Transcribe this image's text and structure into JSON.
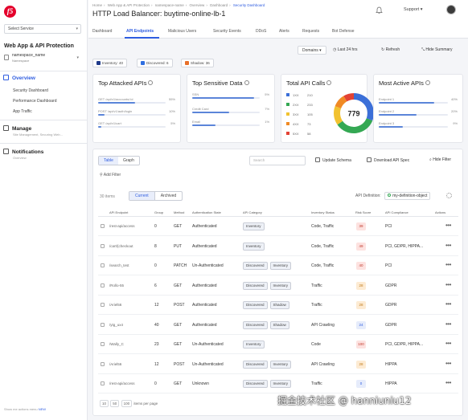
{
  "sidebar": {
    "logo": "f5",
    "select_service": "Select Service",
    "app_title": "Web App & API Protection",
    "namespace_name": "namespace_name",
    "namespace_sub": "Namespace",
    "overview": "Overview",
    "overview_items": [
      "Security Dashboard",
      "Performance Dashboard",
      "App Traffic"
    ],
    "manage": "Manage",
    "manage_sub": "Site Management, Securing Web...",
    "notifications": "Notifications",
    "notifications_sub": "Overview",
    "footer": "Show me actions menu",
    "footer_toggle": "NEW"
  },
  "header": {
    "breadcrumb": [
      "Home",
      "Web App & API Protection",
      "namespace-name",
      "Overview",
      "Dashboard",
      "Security Dashboard"
    ],
    "title": "HTTP Load Balancer: buytime-online-lb-1",
    "support": "Support"
  },
  "tabs": [
    "Dashboard",
    "API Endpoints",
    "Malicious Users",
    "Security Events",
    "DDoS",
    "Alerts",
    "Requests",
    "Bot Defense"
  ],
  "active_tab": "API Endpoints",
  "controls": {
    "dropdown": "Domains",
    "time": "Last 24 hrs",
    "refresh": "Refresh",
    "hide_summary": "Hide Summary"
  },
  "chips": [
    {
      "label": "Inventory: 40",
      "color": "#1f3a8a"
    },
    {
      "label": "Discovered: 6",
      "color": "#2f6fe0"
    },
    {
      "label": "Shadow: 36",
      "color": "#e8702a"
    }
  ],
  "cards": {
    "top_attacked": {
      "title": "Top Attacked APIs",
      "rows": [
        {
          "label": "GET /api/v1/accounts/:id",
          "pct": "55%",
          "fill": 0.55
        },
        {
          "label": "POST /api/v1/auth/login",
          "pct": "10%",
          "fill": 0.1
        },
        {
          "label": "GET /api/v1/cart",
          "pct": "5%",
          "fill": 0.05
        }
      ]
    },
    "top_sensitive": {
      "title": "Top Sensitive Data",
      "rows": [
        {
          "label": "SSN",
          "pct": "5%",
          "fill": 0.92
        },
        {
          "label": "Credit Card",
          "pct": "7%",
          "fill": 0.55
        },
        {
          "label": "Email",
          "pct": "1%",
          "fill": 0.35
        }
      ]
    },
    "total_calls": {
      "title": "Total API Calls",
      "total": "779",
      "rows": [
        {
          "code": "1XX",
          "value": "210",
          "color": "#3b6fd8"
        },
        {
          "code": "2XX",
          "value": "233",
          "color": "#34a853"
        },
        {
          "code": "3XX",
          "value": "105",
          "color": "#f2c230"
        },
        {
          "code": "4XX",
          "value": "73",
          "color": "#f08a24"
        },
        {
          "code": "5XX",
          "value": "58",
          "color": "#e34234"
        }
      ]
    },
    "most_active": {
      "title": "Most Active APIs",
      "rows": [
        {
          "label": "Endpoint 1",
          "pct": "40%",
          "fill": 0.8
        },
        {
          "label": "Endpoint 2",
          "pct": "20%",
          "fill": 0.55
        },
        {
          "label": "Endpoint 3",
          "pct": "9%",
          "fill": 0.35
        }
      ]
    }
  },
  "toolbar": {
    "views": [
      "Table",
      "Graph"
    ],
    "search_placeholder": "Search",
    "update_schema": "Update Schema",
    "download_spec": "Download API Spec",
    "hide_filter": "Hide Filter",
    "add_filter": "Add Filter"
  },
  "table_head": {
    "count": "30 items",
    "segments": [
      "Current",
      "Archived"
    ],
    "api_definition_label": "API Definition:",
    "api_definition_value": "my-definition-object"
  },
  "columns": [
    "API Endpoint",
    "Group",
    "Method",
    "Authentication State",
    "API Category",
    "Inventory Status",
    "Risk Score",
    "API Compliance",
    "Actions"
  ],
  "rows": [
    {
      "endpoint": "/rest-api/access",
      "group": "0",
      "method": "GET",
      "auth": "Authenticated",
      "cats": [
        "Inventory"
      ],
      "status": "Code, Traffic",
      "risk": "39",
      "compliance": "PCI"
    },
    {
      "endpoint": "/cart/{checkout",
      "group": "8",
      "method": "PUT",
      "auth": "Authenticated",
      "cats": [
        "Inventory"
      ],
      "status": "Code, Traffic",
      "risk": "49",
      "compliance": "PCI, GDPR, HIPPA..."
    },
    {
      "endpoint": "/search_test",
      "group": "0",
      "method": "PATCH",
      "auth": "Un-Authenticated",
      "cats": [
        "Discovered",
        "Inventory"
      ],
      "status": "Code, Traffic",
      "risk": "40",
      "compliance": "PCI"
    },
    {
      "endpoint": "/Rollo-55",
      "group": "6",
      "method": "GET",
      "auth": "Authenticated",
      "cats": [
        "Discovered",
        "Inventory"
      ],
      "status": "Traffic",
      "risk": "28",
      "compliance": "GDPR"
    },
    {
      "endpoint": "/Ariel56",
      "group": "12",
      "method": "POST",
      "auth": "Authenticated",
      "cats": [
        "Discovered",
        "Shadow"
      ],
      "status": "Traffic",
      "risk": "28",
      "compliance": "GDPR"
    },
    {
      "endpoint": "/ytg_ux4",
      "group": "40",
      "method": "GET",
      "auth": "Authenticated",
      "cats": [
        "Discovered",
        "Shadow"
      ],
      "status": "API Crawling",
      "risk": "24",
      "compliance": "GDPR"
    },
    {
      "endpoint": "/Wally_C",
      "group": "23",
      "method": "GET",
      "auth": "Un-Authenticated",
      "cats": [
        "Inventory"
      ],
      "status": "Code",
      "risk": "100",
      "compliance": "PCI, GDPR, HIPPA..."
    },
    {
      "endpoint": "/Ariel56",
      "group": "12",
      "method": "POST",
      "auth": "Un-Authenticated",
      "cats": [
        "Discovered",
        "Inventory"
      ],
      "status": "API Crawling",
      "risk": "28",
      "compliance": "HIPPA"
    },
    {
      "endpoint": "/rest-api/access",
      "group": "0",
      "method": "GET",
      "auth": "Unknown",
      "cats": [
        "Discovered",
        "Inventory"
      ],
      "status": "Traffic",
      "risk": "0",
      "compliance": "HIPPA"
    }
  ],
  "pager": {
    "sizes": [
      "10",
      "50",
      "100"
    ],
    "label": "items per page"
  },
  "risk_colors": {
    "high": "#fde2e0",
    "high_text": "#c0392b",
    "mid": "#fdebd3",
    "mid_text": "#c07a1a",
    "low": "#e6ecfb",
    "low_text": "#2f5de0"
  },
  "watermark": "掘金技术社区 @ hanniuniu12"
}
